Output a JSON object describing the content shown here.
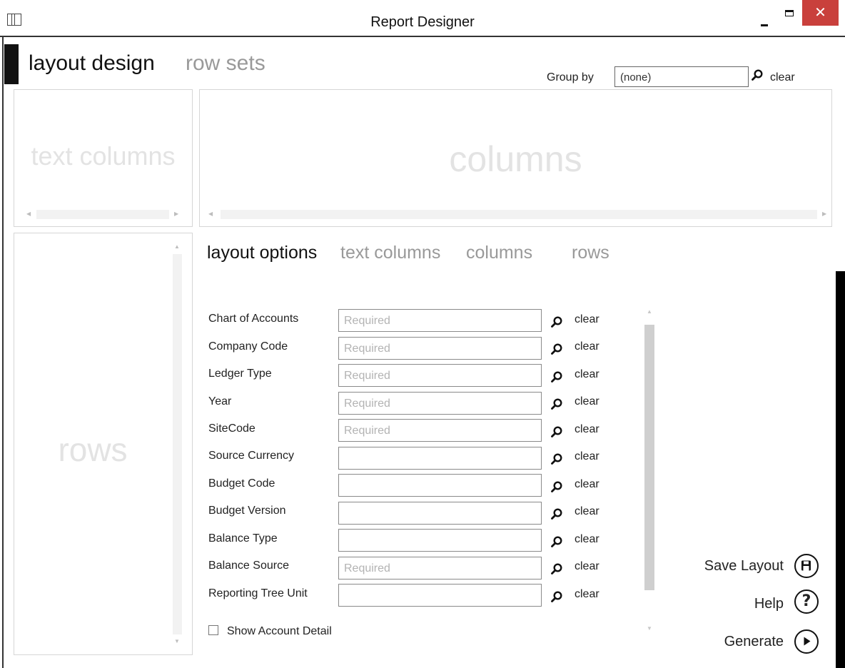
{
  "window": {
    "title": "Report Designer",
    "close_glyph": "✕"
  },
  "tabs": [
    {
      "label": "layout design",
      "active": true
    },
    {
      "label": "row sets",
      "active": false
    }
  ],
  "group_by": {
    "label": "Group by",
    "value": "(none)",
    "clear": "clear"
  },
  "panels": {
    "text_columns": "text columns",
    "columns": "columns",
    "rows": "rows"
  },
  "option_tabs": [
    {
      "label": "layout options",
      "active": true
    },
    {
      "label": "text columns",
      "active": false
    },
    {
      "label": "columns",
      "active": false
    },
    {
      "label": "rows",
      "active": false
    }
  ],
  "fields": [
    {
      "label": "Chart of Accounts",
      "placeholder": "Required",
      "clear": "clear"
    },
    {
      "label": "Company Code",
      "placeholder": "Required",
      "clear": "clear"
    },
    {
      "label": "Ledger Type",
      "placeholder": "Required",
      "clear": "clear"
    },
    {
      "label": "Year",
      "placeholder": "Required",
      "clear": "clear"
    },
    {
      "label": "SiteCode",
      "placeholder": "Required",
      "clear": "clear"
    },
    {
      "label": "Source Currency",
      "placeholder": "",
      "clear": "clear"
    },
    {
      "label": "Budget Code",
      "placeholder": "",
      "clear": "clear"
    },
    {
      "label": "Budget Version",
      "placeholder": "",
      "clear": "clear"
    },
    {
      "label": "Balance Type",
      "placeholder": "",
      "clear": "clear"
    },
    {
      "label": "Balance Source",
      "placeholder": "Required",
      "clear": "clear"
    },
    {
      "label": "Reporting Tree Unit",
      "placeholder": "",
      "clear": "clear"
    }
  ],
  "show_account_detail": {
    "label": "Show Account Detail",
    "checked": false
  },
  "actions": {
    "save_layout": "Save Layout",
    "help": "Help",
    "help_glyph": "?",
    "generate": "Generate"
  },
  "icons": {
    "search": "search-icon",
    "save": "floppy-disk-icon",
    "help": "question-icon",
    "generate": "play-icon"
  },
  "colors": {
    "close_button": "#c9403c",
    "watermark": "#e3e3e3",
    "inactive_tab": "#999999"
  }
}
